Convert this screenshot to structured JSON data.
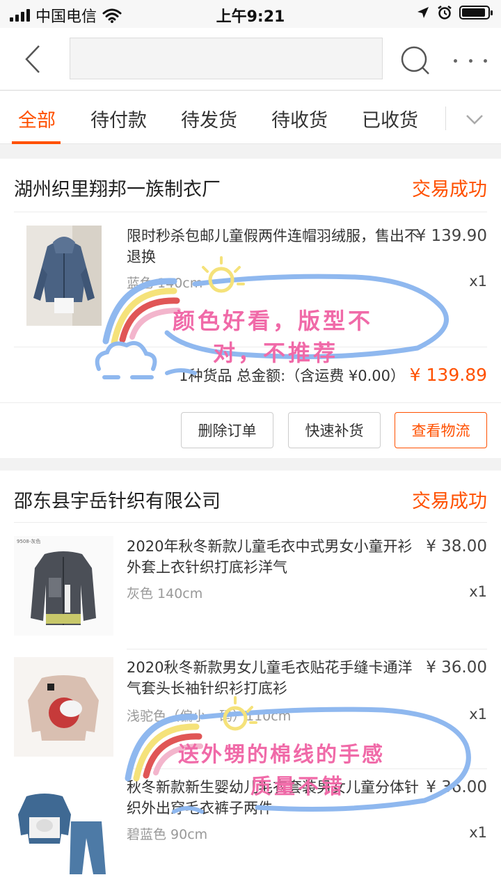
{
  "status_bar": {
    "carrier": "中国电信",
    "time": "上午9:21"
  },
  "nav": {
    "search_placeholder": ""
  },
  "tabs": [
    {
      "label": "全部",
      "active": true
    },
    {
      "label": "待付款"
    },
    {
      "label": "待发货"
    },
    {
      "label": "待收货"
    },
    {
      "label": "已收货"
    }
  ],
  "orders": [
    {
      "shop": "湖州织里翔邦一族制衣厂",
      "status": "交易成功",
      "items": [
        {
          "title": "限时秒杀包邮儿童假两件连帽羽绒服，售出不退换",
          "sku": "蓝色 140cm",
          "price": "¥ 139.90",
          "qty": "x1"
        }
      ],
      "summary_label": "1种货品 总金额:（含运费 ¥0.00）",
      "total": "¥ 139.89",
      "buttons": [
        "删除订单",
        "快速补货",
        "查看物流"
      ]
    },
    {
      "shop": "邵东县宇岳针织有限公司",
      "status": "交易成功",
      "items": [
        {
          "thumb_label": "9508-灰色",
          "title": "2020年秋冬新款儿童毛衣中式男女小童开衫外套上衣针织打底衫洋气",
          "sku": "灰色 140cm",
          "price": "¥ 38.00",
          "qty": "x1"
        },
        {
          "title": "2020秋冬新款男女儿童毛衣贴花手缝卡通洋气套头长袖针织衫打底衫",
          "sku": "浅驼色（偏小一码）110cm",
          "price": "¥ 36.00",
          "qty": "x1"
        },
        {
          "title": "秋冬新款新生婴幼儿毛衣套装男女儿童分体针织外出穿毛衣裤子两件",
          "sku": "碧蓝色 90cm",
          "price": "¥ 36.00",
          "qty": "x1"
        }
      ]
    }
  ],
  "annotations": [
    {
      "line1": "颜色好看，版型不",
      "line2": "对，不推荐"
    },
    {
      "line1": "送外甥的棉线的手感",
      "line2": "质量不错"
    }
  ],
  "colors": {
    "accent": "#ff5000",
    "annotation_text": "#f06aa8",
    "annotation_outline": "#8fb8ef"
  }
}
